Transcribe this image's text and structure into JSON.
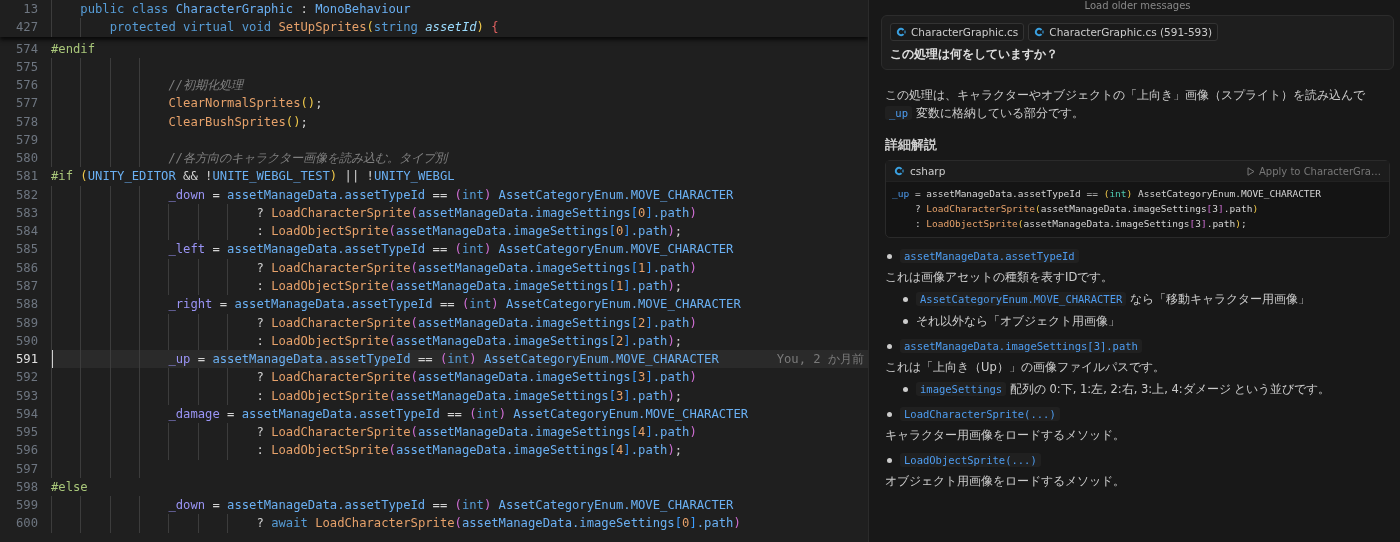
{
  "editor": {
    "sticky_lines": [
      {
        "number": "13",
        "kind": "member",
        "tokens": [
          {
            "kind": "kw",
            "text": "public class "
          },
          {
            "kind": "type",
            "text": "CharacterGraphic"
          },
          {
            "kind": "op",
            "text": " : "
          },
          {
            "kind": "type",
            "text": "MonoBehaviour"
          }
        ]
      },
      {
        "number": "427",
        "kind": "method",
        "tokens": [
          {
            "kind": "kw",
            "text": "protected virtual void "
          },
          {
            "kind": "fn",
            "text": "SetUpSprites"
          },
          {
            "kind": "p2",
            "text": "("
          },
          {
            "kind": "kw",
            "text": "string "
          },
          {
            "kind": "param",
            "text": "assetId"
          },
          {
            "kind": "p2",
            "text": ")"
          },
          {
            "kind": "err",
            "text": " {"
          }
        ]
      }
    ],
    "lines": [
      {
        "number": "574",
        "kind": "directive",
        "selected": false,
        "tokens": [
          {
            "kind": "pre",
            "text": "#endif"
          }
        ]
      },
      {
        "number": "575",
        "kind": "body",
        "selected": false
      },
      {
        "number": "576",
        "kind": "body",
        "selected": false,
        "tokens": [
          {
            "kind": "comment",
            "text": "//初期化処理"
          }
        ]
      },
      {
        "number": "577",
        "kind": "body",
        "selected": false,
        "tokens": [
          {
            "kind": "fn",
            "text": "ClearNormalSprites"
          },
          {
            "kind": "p2",
            "text": "()"
          },
          {
            "kind": "op",
            "text": ";"
          }
        ]
      },
      {
        "number": "578",
        "kind": "body",
        "selected": false,
        "tokens": [
          {
            "kind": "fn",
            "text": "ClearBushSprites"
          },
          {
            "kind": "p2",
            "text": "()"
          },
          {
            "kind": "op",
            "text": ";"
          }
        ]
      },
      {
        "number": "579",
        "kind": "body",
        "selected": false
      },
      {
        "number": "580",
        "kind": "body",
        "selected": false,
        "tokens": [
          {
            "kind": "comment",
            "text": "//各方向のキャラクター画像を読み込む。タイプ別"
          }
        ]
      },
      {
        "number": "581",
        "kind": "directive",
        "selected": false,
        "tokens": [
          {
            "kind": "pre",
            "text": "#if "
          },
          {
            "kind": "p2",
            "text": "("
          },
          {
            "kind": "id",
            "text": "UNITY_EDITOR"
          },
          {
            "kind": "op",
            "text": " && !"
          },
          {
            "kind": "id",
            "text": "UNITE_WEBGL_TEST"
          },
          {
            "kind": "p2",
            "text": ")"
          },
          {
            "kind": "op",
            "text": " || !"
          },
          {
            "kind": "id",
            "text": "UNITY_WEBGL"
          }
        ]
      },
      {
        "number": "582",
        "kind": "body",
        "selected": false,
        "tokens": [
          {
            "kind": "var",
            "text": "_down"
          },
          {
            "kind": "op",
            "text": " = "
          },
          {
            "kind": "id",
            "text": "assetManageData.assetTypeId"
          },
          {
            "kind": "op",
            "text": " == "
          },
          {
            "kind": "p1",
            "text": "("
          },
          {
            "kind": "kw",
            "text": "int"
          },
          {
            "kind": "p1",
            "text": ")"
          },
          {
            "kind": "id",
            "text": " AssetCategoryEnum.MOVE_CHARACTER"
          }
        ]
      },
      {
        "number": "583",
        "kind": "continuation",
        "selected": false,
        "tokens": [
          {
            "kind": "op",
            "text": "? "
          },
          {
            "kind": "fn",
            "text": "LoadCharacterSprite"
          },
          {
            "kind": "p1",
            "text": "("
          },
          {
            "kind": "id",
            "text": "assetManageData.imageSettings"
          },
          {
            "kind": "p3",
            "text": "["
          },
          {
            "kind": "num",
            "text": "0"
          },
          {
            "kind": "p3",
            "text": "]"
          },
          {
            "kind": "id",
            "text": ".path"
          },
          {
            "kind": "p1",
            "text": ")"
          }
        ]
      },
      {
        "number": "584",
        "kind": "continuation",
        "selected": false,
        "tokens": [
          {
            "kind": "op",
            "text": ": "
          },
          {
            "kind": "fn",
            "text": "LoadObjectSprite"
          },
          {
            "kind": "p1",
            "text": "("
          },
          {
            "kind": "id",
            "text": "assetManageData.imageSettings"
          },
          {
            "kind": "p3",
            "text": "["
          },
          {
            "kind": "num",
            "text": "0"
          },
          {
            "kind": "p3",
            "text": "]"
          },
          {
            "kind": "id",
            "text": ".path"
          },
          {
            "kind": "p1",
            "text": ")"
          },
          {
            "kind": "op",
            "text": ";"
          }
        ]
      },
      {
        "number": "585",
        "kind": "body",
        "selected": false,
        "tokens": [
          {
            "kind": "var",
            "text": "_left"
          },
          {
            "kind": "op",
            "text": " = "
          },
          {
            "kind": "id",
            "text": "assetManageData.assetTypeId"
          },
          {
            "kind": "op",
            "text": " == "
          },
          {
            "kind": "p1",
            "text": "("
          },
          {
            "kind": "kw",
            "text": "int"
          },
          {
            "kind": "p1",
            "text": ")"
          },
          {
            "kind": "id",
            "text": " AssetCategoryEnum.MOVE_CHARACTER"
          }
        ]
      },
      {
        "number": "586",
        "kind": "continuation",
        "selected": false,
        "tokens": [
          {
            "kind": "op",
            "text": "? "
          },
          {
            "kind": "fn",
            "text": "LoadCharacterSprite"
          },
          {
            "kind": "p1",
            "text": "("
          },
          {
            "kind": "id",
            "text": "assetManageData.imageSettings"
          },
          {
            "kind": "p3",
            "text": "["
          },
          {
            "kind": "num",
            "text": "1"
          },
          {
            "kind": "p3",
            "text": "]"
          },
          {
            "kind": "id",
            "text": ".path"
          },
          {
            "kind": "p1",
            "text": ")"
          }
        ]
      },
      {
        "number": "587",
        "kind": "continuation",
        "selected": false,
        "tokens": [
          {
            "kind": "op",
            "text": ": "
          },
          {
            "kind": "fn",
            "text": "LoadObjectSprite"
          },
          {
            "kind": "p1",
            "text": "("
          },
          {
            "kind": "id",
            "text": "assetManageData.imageSettings"
          },
          {
            "kind": "p3",
            "text": "["
          },
          {
            "kind": "num",
            "text": "1"
          },
          {
            "kind": "p3",
            "text": "]"
          },
          {
            "kind": "id",
            "text": ".path"
          },
          {
            "kind": "p1",
            "text": ")"
          },
          {
            "kind": "op",
            "text": ";"
          }
        ]
      },
      {
        "number": "588",
        "kind": "body",
        "selected": false,
        "tokens": [
          {
            "kind": "var",
            "text": "_right"
          },
          {
            "kind": "op",
            "text": " = "
          },
          {
            "kind": "id",
            "text": "assetManageData.assetTypeId"
          },
          {
            "kind": "op",
            "text": " == "
          },
          {
            "kind": "p1",
            "text": "("
          },
          {
            "kind": "kw",
            "text": "int"
          },
          {
            "kind": "p1",
            "text": ")"
          },
          {
            "kind": "id",
            "text": " AssetCategoryEnum.MOVE_CHARACTER"
          }
        ]
      },
      {
        "number": "589",
        "kind": "continuation",
        "selected": false,
        "tokens": [
          {
            "kind": "op",
            "text": "? "
          },
          {
            "kind": "fn",
            "text": "LoadCharacterSprite"
          },
          {
            "kind": "p1",
            "text": "("
          },
          {
            "kind": "id",
            "text": "assetManageData.imageSettings"
          },
          {
            "kind": "p3",
            "text": "["
          },
          {
            "kind": "num",
            "text": "2"
          },
          {
            "kind": "p3",
            "text": "]"
          },
          {
            "kind": "id",
            "text": ".path"
          },
          {
            "kind": "p1",
            "text": ")"
          }
        ]
      },
      {
        "number": "590",
        "kind": "continuation",
        "selected": false,
        "tokens": [
          {
            "kind": "op",
            "text": ": "
          },
          {
            "kind": "fn",
            "text": "LoadObjectSprite"
          },
          {
            "kind": "p1",
            "text": "("
          },
          {
            "kind": "id",
            "text": "assetManageData.imageSettings"
          },
          {
            "kind": "p3",
            "text": "["
          },
          {
            "kind": "num",
            "text": "2"
          },
          {
            "kind": "p3",
            "text": "]"
          },
          {
            "kind": "id",
            "text": ".path"
          },
          {
            "kind": "p1",
            "text": ")"
          },
          {
            "kind": "op",
            "text": ";"
          }
        ]
      },
      {
        "number": "591",
        "kind": "body",
        "selected": true,
        "blame": "You, 2 か月前",
        "tokens": [
          {
            "kind": "var",
            "text": "_up"
          },
          {
            "kind": "op",
            "text": " = "
          },
          {
            "kind": "id",
            "text": "assetManageData.assetTypeId"
          },
          {
            "kind": "op",
            "text": " == "
          },
          {
            "kind": "p1",
            "text": "("
          },
          {
            "kind": "kw",
            "text": "int"
          },
          {
            "kind": "p1",
            "text": ")"
          },
          {
            "kind": "id",
            "text": " AssetCategoryEnum.MOVE_CHARACTER"
          }
        ]
      },
      {
        "number": "592",
        "kind": "continuation",
        "selected": false,
        "tokens": [
          {
            "kind": "op",
            "text": "? "
          },
          {
            "kind": "fn",
            "text": "LoadCharacterSprite"
          },
          {
            "kind": "p1",
            "text": "("
          },
          {
            "kind": "id",
            "text": "assetManageData.imageSettings"
          },
          {
            "kind": "p3",
            "text": "["
          },
          {
            "kind": "num",
            "text": "3"
          },
          {
            "kind": "p3",
            "text": "]"
          },
          {
            "kind": "id",
            "text": ".path"
          },
          {
            "kind": "p1",
            "text": ")"
          }
        ]
      },
      {
        "number": "593",
        "kind": "continuation",
        "selected": false,
        "tokens": [
          {
            "kind": "op",
            "text": ": "
          },
          {
            "kind": "fn",
            "text": "LoadObjectSprite"
          },
          {
            "kind": "p1",
            "text": "("
          },
          {
            "kind": "id",
            "text": "assetManageData.imageSettings"
          },
          {
            "kind": "p3",
            "text": "["
          },
          {
            "kind": "num",
            "text": "3"
          },
          {
            "kind": "p3",
            "text": "]"
          },
          {
            "kind": "id",
            "text": ".path"
          },
          {
            "kind": "p1",
            "text": ")"
          },
          {
            "kind": "op",
            "text": ";"
          }
        ]
      },
      {
        "number": "594",
        "kind": "body",
        "selected": false,
        "tokens": [
          {
            "kind": "var",
            "text": "_damage"
          },
          {
            "kind": "op",
            "text": " = "
          },
          {
            "kind": "id",
            "text": "assetManageData.assetTypeId"
          },
          {
            "kind": "op",
            "text": " == "
          },
          {
            "kind": "p1",
            "text": "("
          },
          {
            "kind": "kw",
            "text": "int"
          },
          {
            "kind": "p1",
            "text": ")"
          },
          {
            "kind": "id",
            "text": " AssetCategoryEnum.MOVE_CHARACTER"
          }
        ]
      },
      {
        "number": "595",
        "kind": "continuation",
        "selected": false,
        "tokens": [
          {
            "kind": "op",
            "text": "? "
          },
          {
            "kind": "fn",
            "text": "LoadCharacterSprite"
          },
          {
            "kind": "p1",
            "text": "("
          },
          {
            "kind": "id",
            "text": "assetManageData.imageSettings"
          },
          {
            "kind": "p3",
            "text": "["
          },
          {
            "kind": "num",
            "text": "4"
          },
          {
            "kind": "p3",
            "text": "]"
          },
          {
            "kind": "id",
            "text": ".path"
          },
          {
            "kind": "p1",
            "text": ")"
          }
        ]
      },
      {
        "number": "596",
        "kind": "continuation",
        "selected": false,
        "tokens": [
          {
            "kind": "op",
            "text": ": "
          },
          {
            "kind": "fn",
            "text": "LoadObjectSprite"
          },
          {
            "kind": "p1",
            "text": "("
          },
          {
            "kind": "id",
            "text": "assetManageData.imageSettings"
          },
          {
            "kind": "p3",
            "text": "["
          },
          {
            "kind": "num",
            "text": "4"
          },
          {
            "kind": "p3",
            "text": "]"
          },
          {
            "kind": "id",
            "text": ".path"
          },
          {
            "kind": "p1",
            "text": ")"
          },
          {
            "kind": "op",
            "text": ";"
          }
        ]
      },
      {
        "number": "597",
        "kind": "body",
        "selected": false
      },
      {
        "number": "598",
        "kind": "directive",
        "selected": false,
        "tokens": [
          {
            "kind": "pre",
            "text": "#else"
          }
        ]
      },
      {
        "number": "599",
        "kind": "body",
        "selected": false,
        "tokens": [
          {
            "kind": "var",
            "text": "_down"
          },
          {
            "kind": "op",
            "text": " = "
          },
          {
            "kind": "id",
            "text": "assetManageData.assetTypeId"
          },
          {
            "kind": "op",
            "text": " == "
          },
          {
            "kind": "p1",
            "text": "("
          },
          {
            "kind": "kw",
            "text": "int"
          },
          {
            "kind": "p1",
            "text": ")"
          },
          {
            "kind": "id",
            "text": " AssetCategoryEnum.MOVE_CHARACTER"
          }
        ]
      },
      {
        "number": "600",
        "kind": "continuation",
        "selected": false,
        "tokens": [
          {
            "kind": "op",
            "text": "? "
          },
          {
            "kind": "kw",
            "text": "await "
          },
          {
            "kind": "fn",
            "text": "LoadCharacterSprite"
          },
          {
            "kind": "p1",
            "text": "("
          },
          {
            "kind": "id",
            "text": "assetManageData.imageSettings"
          },
          {
            "kind": "p3",
            "text": "["
          },
          {
            "kind": "num",
            "text": "0"
          },
          {
            "kind": "p3",
            "text": "]"
          },
          {
            "kind": "id",
            "text": ".path"
          },
          {
            "kind": "p1",
            "text": ")"
          }
        ]
      }
    ]
  },
  "chat": {
    "load_older": "Load older messages",
    "request": {
      "references": [
        "CharacterGraphic.cs",
        "CharacterGraphic.cs (591-593)"
      ],
      "question": "この処理は何をしていますか？"
    },
    "answer": [
      {
        "kind": "text",
        "text": "この処理は、キャラクターやオブジェクトの「上向き」画像（スプライト）を読み込んで "
      },
      {
        "kind": "code",
        "text": "_up"
      },
      {
        "kind": "text",
        "text": " 変数に格納している部分です。"
      }
    ],
    "heading": "詳細解説",
    "code_block": {
      "language": "csharp",
      "apply": "Apply to CharacterGra…",
      "lines": [
        {
          "kind": "first",
          "tokens": [
            {
              "kind": "var2",
              "text": "_up"
            },
            {
              "kind": "op",
              "text": " = assetManageData.assetTypeId == "
            },
            {
              "kind": "p2",
              "text": "("
            },
            {
              "kind": "type2",
              "text": "int"
            },
            {
              "kind": "p2",
              "text": ")"
            },
            {
              "kind": "op",
              "text": " AssetCategoryEnum.MOVE_CHARACTER"
            }
          ]
        },
        {
          "kind": "continuation",
          "tokens": [
            {
              "kind": "op",
              "text": "? "
            },
            {
              "kind": "fn",
              "text": "LoadCharacterSprite"
            },
            {
              "kind": "p2",
              "text": "("
            },
            {
              "kind": "op",
              "text": "assetManageData.imageSettings"
            },
            {
              "kind": "p1",
              "text": "["
            },
            {
              "kind": "op",
              "text": "3"
            },
            {
              "kind": "p1",
              "text": "]"
            },
            {
              "kind": "op",
              "text": ".path"
            },
            {
              "kind": "p2",
              "text": ")"
            }
          ]
        },
        {
          "kind": "continuation",
          "tokens": [
            {
              "kind": "op",
              "text": ": "
            },
            {
              "kind": "fn",
              "text": "LoadObjectSprite"
            },
            {
              "kind": "p2",
              "text": "("
            },
            {
              "kind": "op",
              "text": "assetManageData.imageSettings"
            },
            {
              "kind": "p1",
              "text": "["
            },
            {
              "kind": "op",
              "text": "3"
            },
            {
              "kind": "p1",
              "text": "]"
            },
            {
              "kind": "op",
              "text": ".path"
            },
            {
              "kind": "p2",
              "text": ")"
            },
            {
              "kind": "op",
              "text": ";"
            }
          ]
        }
      ]
    },
    "points": [
      {
        "code": "assetManageData.assetTypeId",
        "description": "これは画像アセットの種類を表すIDです。",
        "sub_points": [
          [
            {
              "kind": "code",
              "text": "AssetCategoryEnum.MOVE_CHARACTER"
            },
            {
              "kind": "text",
              "text": " なら「移動キャラクター用画像」"
            }
          ],
          [
            {
              "kind": "text",
              "text": "それ以外なら「オブジェクト用画像」"
            }
          ]
        ]
      },
      {
        "code": "assetManageData.imageSettings[3].path",
        "description": "これは「上向き（Up）」の画像ファイルパスです。",
        "sub_points": [
          [
            {
              "kind": "code",
              "text": "imageSettings"
            },
            {
              "kind": "text",
              "text": " 配列の 0:下, 1:左, 2:右, 3:上, 4:ダメージ という並びです。"
            }
          ]
        ]
      },
      {
        "code": "LoadCharacterSprite(...)",
        "description": "キャラクター用画像をロードするメソッド。"
      },
      {
        "code": "LoadObjectSprite(...)",
        "description": "オブジェクト用画像をロードするメソッド。"
      }
    ]
  }
}
